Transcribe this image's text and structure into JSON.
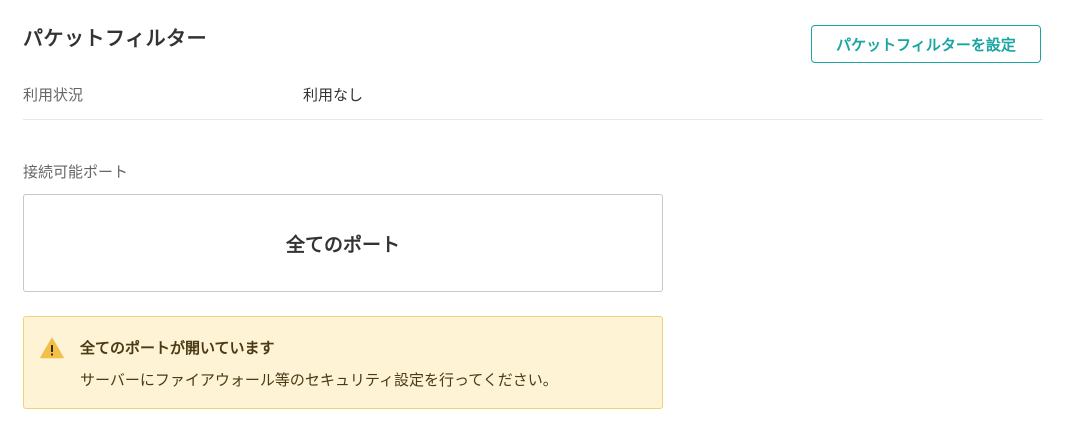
{
  "header": {
    "title": "パケットフィルター",
    "set_button_label": "パケットフィルターを設定"
  },
  "usage": {
    "label": "利用状況",
    "value": "利用なし"
  },
  "ports": {
    "heading": "接続可能ポート",
    "value": "全てのポート"
  },
  "warning": {
    "icon": "warning-triangle-icon",
    "title": "全てのポートが開いています",
    "message": "サーバーにファイアウォール等のセキュリティ設定を行ってください。"
  },
  "colors": {
    "accent": "#1aa5a2",
    "warning_bg": "#fef3d5",
    "warning_border": "#f0d27c",
    "warning_icon": "#f2c04a"
  }
}
